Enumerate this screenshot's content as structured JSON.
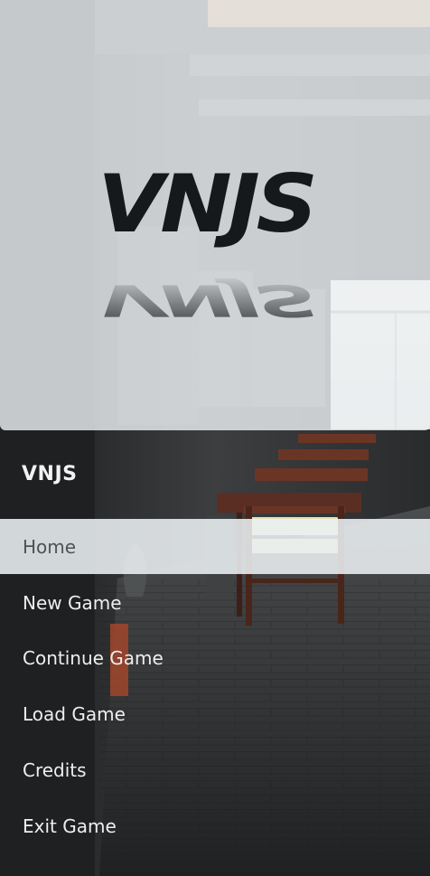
{
  "app": {
    "logo_text": "VNJS"
  },
  "menu": {
    "header": "VNJS",
    "items": [
      {
        "label": "Home",
        "active": true
      },
      {
        "label": "New Game",
        "active": false
      },
      {
        "label": "Continue Game",
        "active": false
      },
      {
        "label": "Load Game",
        "active": false
      },
      {
        "label": "Credits",
        "active": false
      },
      {
        "label": "Exit Game",
        "active": false
      }
    ]
  },
  "colors": {
    "hero_overlay": "#f0f4f6",
    "logo": "#16191b",
    "active_item_bg": "#ecf0f2",
    "active_item_text": "#4e5256",
    "menu_text": "#eeeeee",
    "background_floor": "#2b2d2f"
  }
}
